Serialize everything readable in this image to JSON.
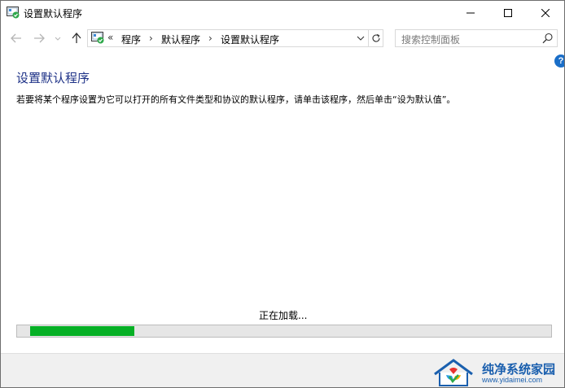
{
  "window": {
    "title": "设置默认程序"
  },
  "titlebar_controls": {
    "minimize_icon": "minimize-icon",
    "maximize_icon": "maximize-icon",
    "close_icon": "close-icon"
  },
  "navigation": {
    "back_icon": "arrow-left-icon",
    "forward_icon": "arrow-right-icon",
    "recent_icon": "chevron-down-icon",
    "up_icon": "arrow-up-icon",
    "address": {
      "overflow": "«",
      "breadcrumbs": [
        "程序",
        "默认程序",
        "设置默认程序"
      ],
      "separator": "›"
    },
    "search": {
      "placeholder": "搜索控制面板"
    }
  },
  "help": {
    "label": "?"
  },
  "content": {
    "title": "设置默认程序",
    "description": "若要将某个程序设置为它可以打开的所有文件类型和协议的默认程序，请单击该程序，然后单击“设为默认值”。",
    "loading_text": "正在加载...",
    "progress_fraction": 0.2
  },
  "watermark": {
    "title": "纯净系统家园",
    "url": "www.yidaimei.com"
  },
  "colors": {
    "accent": "#1e3287",
    "progress": "#06b025",
    "help": "#1a6ec8",
    "brand": "#1a5fae"
  }
}
